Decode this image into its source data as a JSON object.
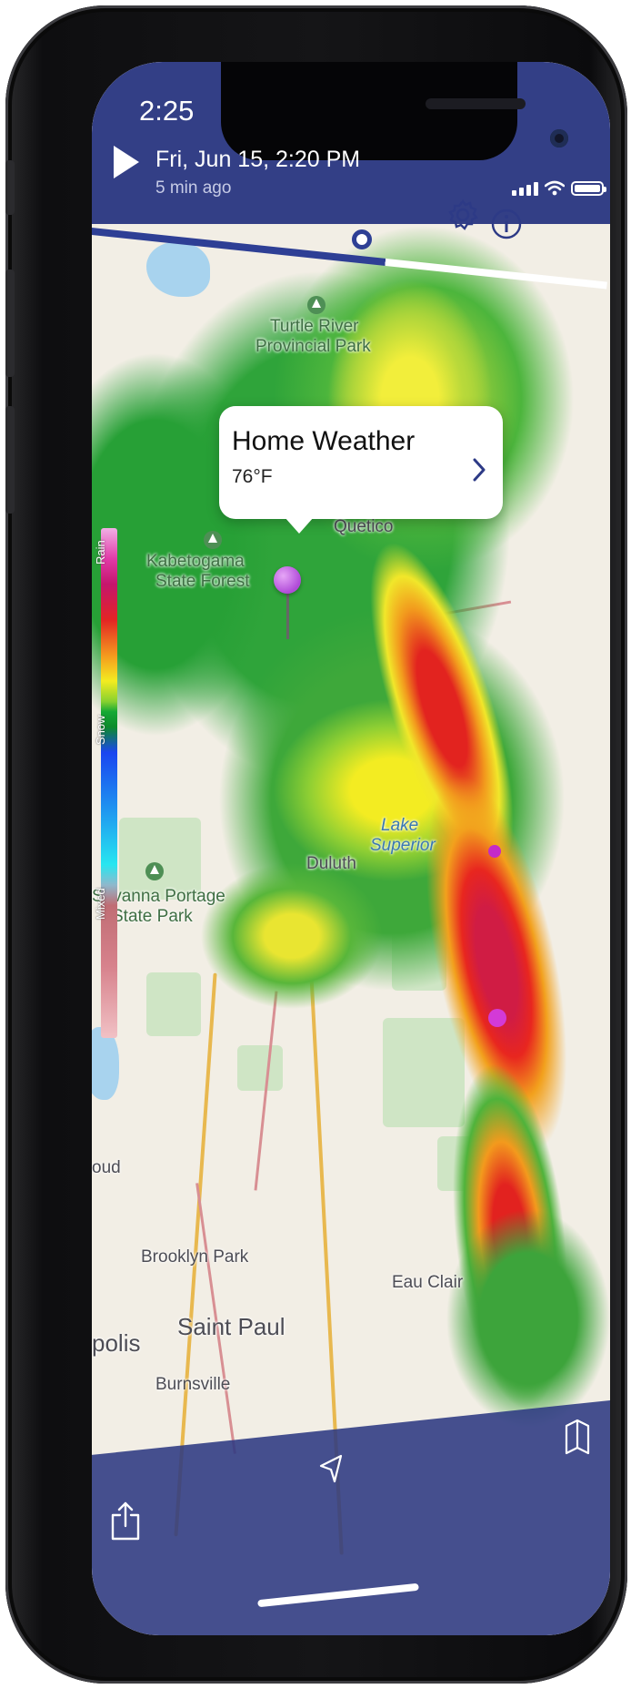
{
  "status_bar": {
    "time": "2:25"
  },
  "header": {
    "play_icon": "play-icon",
    "date": "Fri, Jun 15, 2:20 PM",
    "ago": "5 min ago",
    "timeline_progress": 0.57
  },
  "controls": {
    "settings_icon": "gear-icon",
    "info_icon": "info-icon"
  },
  "legend": {
    "rain": "Rain",
    "snow": "Snow",
    "mixed": "Mixed"
  },
  "callout": {
    "title": "Home Weather",
    "temperature": "76°F"
  },
  "map_labels": {
    "turtle_river_1": "Turtle River",
    "turtle_river_2": "Provincial Park",
    "kabetogama_1": "Kabetogama",
    "kabetogama_2": "State Forest",
    "quetico": "Quetico",
    "lake_1": "Lake",
    "lake_2": "Superior",
    "duluth": "Duluth",
    "savanna_1": "Savanna Portage",
    "savanna_2": "State Park",
    "cloud": "oud",
    "brooklyn": "Brooklyn Park",
    "saint_paul": "Saint Paul",
    "polis": "polis",
    "eau_claire": "Eau Clair",
    "burnsville": "Burnsville"
  },
  "bottom_bar": {
    "share_icon": "share-icon",
    "location_icon": "location-arrow-icon",
    "map_icon": "map-icon"
  },
  "colors": {
    "header": "#2c3982",
    "accent": "#2e3f95",
    "pin": "#b04ad8"
  }
}
